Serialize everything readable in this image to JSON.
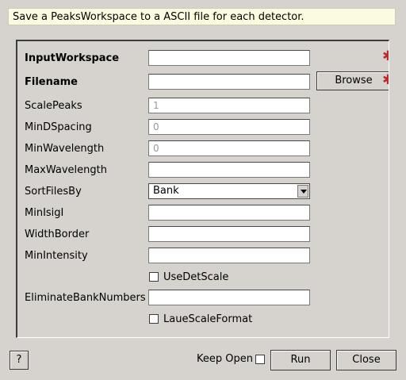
{
  "description": "Save a PeaksWorkspace to a ASCII file for each detector.",
  "fields": {
    "input_workspace": {
      "label": "InputWorkspace",
      "value": ""
    },
    "filename": {
      "label": "Filename",
      "value": ""
    },
    "browse_label": "Browse",
    "scale_peaks": {
      "label": "ScalePeaks",
      "placeholder": "1"
    },
    "min_d_spacing": {
      "label": "MinDSpacing",
      "placeholder": "0"
    },
    "min_wavelength": {
      "label": "MinWavelength",
      "placeholder": "0"
    },
    "max_wavelength": {
      "label": "MaxWavelength",
      "value": ""
    },
    "sort_files_by": {
      "label": "SortFilesBy",
      "selected": "Bank"
    },
    "min_isig_i": {
      "label": "MinIsigI",
      "value": ""
    },
    "width_border": {
      "label": "WidthBorder",
      "value": ""
    },
    "min_intensity": {
      "label": "MinIntensity",
      "value": ""
    },
    "use_det_scale": {
      "label": "UseDetScale",
      "checked": false
    },
    "eliminate_bank_numbers": {
      "label": "EliminateBankNumbers",
      "value": ""
    },
    "laue_scale_format": {
      "label": "LaueScaleFormat",
      "checked": false
    }
  },
  "required_marker": "✱",
  "footer": {
    "help_label": "?",
    "keep_open_label": "Keep Open",
    "run_label": "Run",
    "close_label": "Close"
  }
}
